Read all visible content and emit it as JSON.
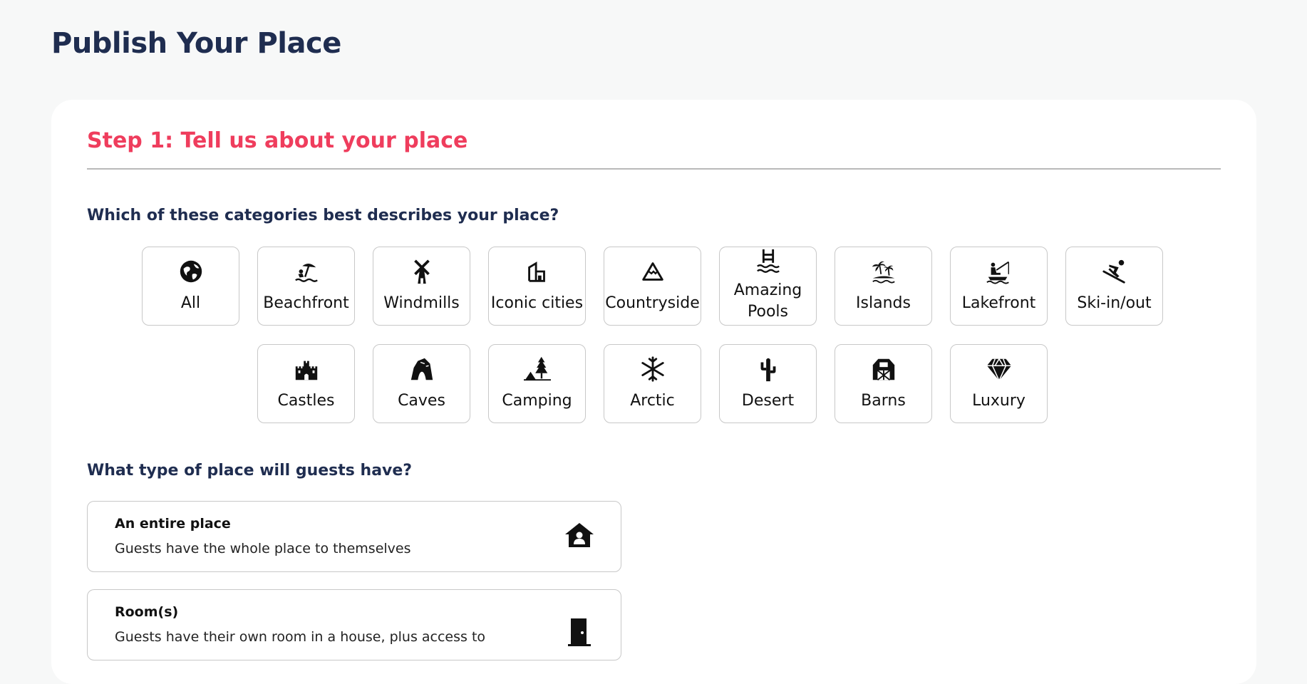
{
  "page": {
    "title": "Publish Your Place"
  },
  "step": {
    "title": "Step 1: Tell us about your place"
  },
  "categories_question": "Which of these categories best describes your place?",
  "categories": [
    {
      "label": "All",
      "icon": "globe-icon"
    },
    {
      "label": "Beachfront",
      "icon": "umbrella-beach-icon"
    },
    {
      "label": "Windmills",
      "icon": "windmill-icon"
    },
    {
      "label": "Iconic cities",
      "icon": "city-icon"
    },
    {
      "label": "Countryside",
      "icon": "mountain-icon"
    },
    {
      "label": "Amazing Pools",
      "icon": "pool-ladder-icon"
    },
    {
      "label": "Islands",
      "icon": "palm-island-icon"
    },
    {
      "label": "Lakefront",
      "icon": "fishing-icon"
    },
    {
      "label": "Ski-in/out",
      "icon": "skiing-icon"
    },
    {
      "label": "Castles",
      "icon": "castle-icon"
    },
    {
      "label": "Caves",
      "icon": "cave-icon"
    },
    {
      "label": "Camping",
      "icon": "tent-tree-icon"
    },
    {
      "label": "Arctic",
      "icon": "snowflake-icon"
    },
    {
      "label": "Desert",
      "icon": "cactus-icon"
    },
    {
      "label": "Barns",
      "icon": "barn-icon"
    },
    {
      "label": "Luxury",
      "icon": "diamond-icon"
    }
  ],
  "type_question": "What type of place will guests have?",
  "place_types": [
    {
      "title": "An entire place",
      "desc": "Guests have the whole place to themselves",
      "icon": "house-user-icon"
    },
    {
      "title": "Room(s)",
      "desc": "Guests have their own room in a house, plus access to",
      "icon": "door-icon"
    }
  ]
}
